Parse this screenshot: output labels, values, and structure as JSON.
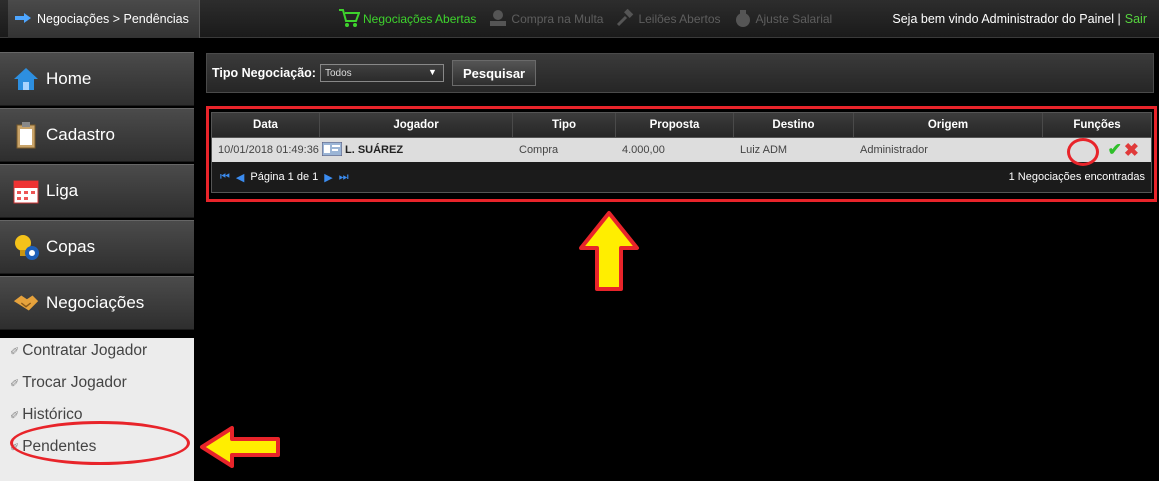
{
  "topbar": {
    "breadcrumb": "Negociações > Pendências",
    "nav": [
      {
        "label": "Negociações Abertas",
        "icon": "cart-icon",
        "active": true
      },
      {
        "label": "Compra na Multa",
        "icon": "money-icon",
        "active": false
      },
      {
        "label": "Leilões Abertos",
        "icon": "gavel-icon",
        "active": false
      },
      {
        "label": "Ajuste Salarial",
        "icon": "money-bag-icon",
        "active": false
      }
    ],
    "welcome": "Seja bem vindo Administrador do Painel |",
    "logout": "Sair"
  },
  "sidebar": {
    "items": [
      {
        "label": "Home",
        "icon": "home-icon"
      },
      {
        "label": "Cadastro",
        "icon": "clipboard-icon"
      },
      {
        "label": "Liga",
        "icon": "calendar-icon"
      },
      {
        "label": "Copas",
        "icon": "trophy-icon"
      },
      {
        "label": "Negociações",
        "icon": "handshake-icon"
      }
    ],
    "subitems": [
      {
        "label": "Contratar Jogador"
      },
      {
        "label": "Trocar Jogador"
      },
      {
        "label": "Histórico"
      },
      {
        "label": "Pendentes"
      }
    ]
  },
  "filter": {
    "label": "Tipo Negociação:",
    "selected": "Todos",
    "search_button": "Pesquisar"
  },
  "table": {
    "columns": [
      "Data",
      "Jogador",
      "Tipo",
      "Proposta",
      "Destino",
      "Origem",
      "Funções"
    ],
    "rows": [
      {
        "data": "10/01/2018 01:49:36",
        "jogador": "L. SUÁREZ",
        "tipo": "Compra",
        "proposta": "4.000,00",
        "destino": "Luiz ADM",
        "origem": "Administrador"
      }
    ],
    "pager": "Página 1 de 1",
    "count": "1 Negociações encontradas"
  },
  "colors": {
    "accent_green": "#3ed32d",
    "highlight_red": "#e8242a",
    "arrow_yellow": "#ffee00"
  }
}
